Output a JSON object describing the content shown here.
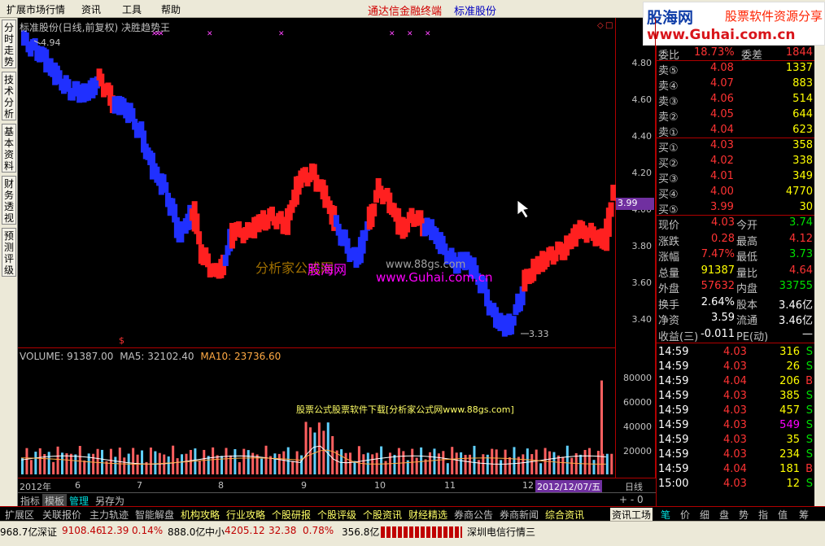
{
  "menu": {
    "items": [
      "扩展市场行情",
      "资讯",
      "工具",
      "帮助"
    ],
    "center1": "通达信金融终端",
    "center2": "标准股份"
  },
  "logo": {
    "line1": "股海网",
    "line1b": "股票软件资源分享",
    "line2": "www.Guhai.com.cn"
  },
  "sidetabs": [
    "分时走势",
    "技术分析",
    "基本资料",
    "财务透视",
    "预测评级"
  ],
  "chart": {
    "title": "标准股份(日线,前复权) 决胜趋势王",
    "high_label": "4.94",
    "low_label": "3.33",
    "price_tag": "3.99",
    "marker": "$"
  },
  "chart_data": {
    "type": "bar",
    "ylim": [
      3.28,
      4.98
    ],
    "yticks": [
      "4.80",
      "4.60",
      "4.40",
      "4.20",
      "4.00",
      "3.80",
      "3.60",
      "3.40"
    ],
    "vol_yticks": [
      "80000",
      "60000",
      "40000",
      "20000"
    ],
    "xlabels": [
      "2012年",
      "6",
      "7",
      "8",
      "9",
      "10",
      "11",
      "12"
    ],
    "current_date": "2012/12/07/五",
    "period": "日线"
  },
  "volume": {
    "label": "VOLUME: 91387.00",
    "ma5": "MA5: 32102.40",
    "ma10": "MA10: 23736.60",
    "note": "股票公式股票软件下载[分析家公式网www.88gs.com]"
  },
  "watermark": {
    "w1": "分析家公式网",
    "w2": "股海网",
    "w3": "www.88gs.com",
    "w4": "www.Guhai.com.cn"
  },
  "tabs": {
    "items": [
      "指标",
      "模板",
      "管理",
      "另存为"
    ],
    "right": "+ - 0"
  },
  "bottomtabs": [
    "扩展区",
    "关联报价",
    "主力轨迹",
    "智能解盘",
    "机构攻略",
    "行业攻略",
    "个股研报",
    "个股评级",
    "个股资讯",
    "财经精选",
    "券商公告",
    "券商新闻",
    "综合资讯"
  ],
  "panel": {
    "ratio": {
      "l1": "委比",
      "v1": "18.73%",
      "l2": "委差",
      "v2": "1844"
    },
    "sells": [
      {
        "l": "卖⑤",
        "p": "4.08",
        "v": "1337"
      },
      {
        "l": "卖④",
        "p": "4.07",
        "v": "883"
      },
      {
        "l": "卖③",
        "p": "4.06",
        "v": "514"
      },
      {
        "l": "卖②",
        "p": "4.05",
        "v": "644"
      },
      {
        "l": "卖①",
        "p": "4.04",
        "v": "623"
      }
    ],
    "buys": [
      {
        "l": "买①",
        "p": "4.03",
        "v": "358"
      },
      {
        "l": "买②",
        "p": "4.02",
        "v": "338"
      },
      {
        "l": "买③",
        "p": "4.01",
        "v": "349"
      },
      {
        "l": "买④",
        "p": "4.00",
        "v": "4770"
      },
      {
        "l": "买⑤",
        "p": "3.99",
        "v": "30"
      }
    ],
    "stats": [
      {
        "l1": "现价",
        "v1": "4.03",
        "l2": "今开",
        "v2": "3.74"
      },
      {
        "l1": "涨跌",
        "v1": "0.28",
        "l2": "最高",
        "v2": "4.12"
      },
      {
        "l1": "涨幅",
        "v1": "7.47%",
        "l2": "最低",
        "v2": "3.73"
      },
      {
        "l1": "总量",
        "v1": "91387",
        "l2": "量比",
        "v2": "4.64"
      },
      {
        "l1": "外盘",
        "v1": "57632",
        "l2": "内盘",
        "v2": "33755"
      },
      {
        "l1": "换手",
        "v1": "2.64%",
        "l2": "股本",
        "v2": "3.46亿"
      },
      {
        "l1": "净资",
        "v1": "3.59",
        "l2": "流通",
        "v2": "3.46亿"
      },
      {
        "l1": "收益(三)",
        "v1": "-0.011",
        "l2": "PE(动)",
        "v2": "—"
      }
    ],
    "ticks": [
      {
        "t": "14:59",
        "p": "4.03",
        "v": "316",
        "s": "S"
      },
      {
        "t": "14:59",
        "p": "4.03",
        "v": "26",
        "s": "S"
      },
      {
        "t": "14:59",
        "p": "4.04",
        "v": "206",
        "s": "B"
      },
      {
        "t": "14:59",
        "p": "4.03",
        "v": "385",
        "s": "S"
      },
      {
        "t": "14:59",
        "p": "4.03",
        "v": "457",
        "s": "S"
      },
      {
        "t": "14:59",
        "p": "4.03",
        "v": "549",
        "s": "S"
      },
      {
        "t": "14:59",
        "p": "4.03",
        "v": "35",
        "s": "S"
      },
      {
        "t": "14:59",
        "p": "4.03",
        "v": "234",
        "s": "S"
      },
      {
        "t": "14:59",
        "p": "4.04",
        "v": "181",
        "s": "B"
      },
      {
        "t": "15:00",
        "p": "4.03",
        "v": "12",
        "s": "S"
      }
    ]
  },
  "ptabs": [
    "笔",
    "价",
    "细",
    "盘",
    "势",
    "指",
    "值",
    "筹"
  ],
  "ptabs_left": "资讯工场",
  "status": {
    "s1": "968.7亿",
    "s2": "深证",
    "s3": "9108.46",
    "s4": "12.39",
    "s5": "0.14%",
    "s6": "888.0亿",
    "s7": "中小",
    "s8": "4205.12",
    "s9": "32.38",
    "s10": "0.78%",
    "s11": "356.8亿",
    "s12": "深圳电信行情三"
  }
}
